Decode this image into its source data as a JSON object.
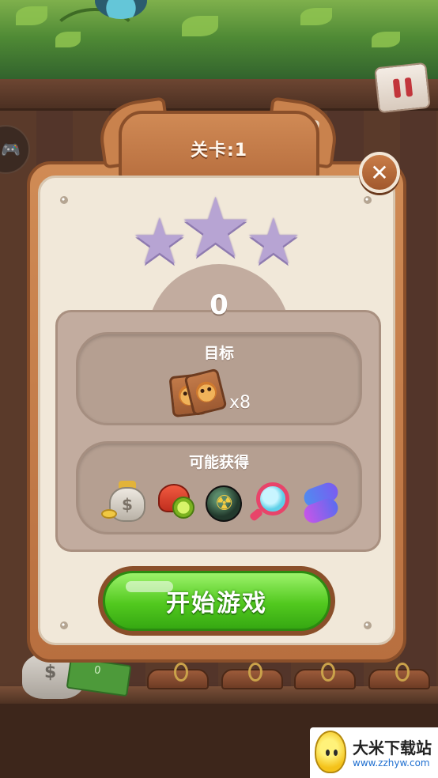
{
  "level": {
    "title": "关卡:1"
  },
  "score": "0",
  "stars": {
    "earned": 0,
    "total": 3
  },
  "goal": {
    "title": "目标",
    "item_icon": "tile-icon",
    "count_label": "x8"
  },
  "rewards": {
    "title": "可能获得",
    "items": [
      "money-bag-icon",
      "alarm-clock-icon",
      "bomb-icon",
      "magnifier-icon",
      "swap-icon"
    ]
  },
  "buttons": {
    "start_label": "开始游戏",
    "close_label": "✕",
    "pause_icon": "pause-icon"
  },
  "background": {
    "money_value": "0"
  },
  "watermark": {
    "name": "大米下载站",
    "url": "www.zzhyw.com"
  },
  "colors": {
    "panel_wood": "#c9824d",
    "panel_cream": "#f1e8d9",
    "start_green": "#52c91f",
    "star_inactive": "#b7a4d3"
  }
}
